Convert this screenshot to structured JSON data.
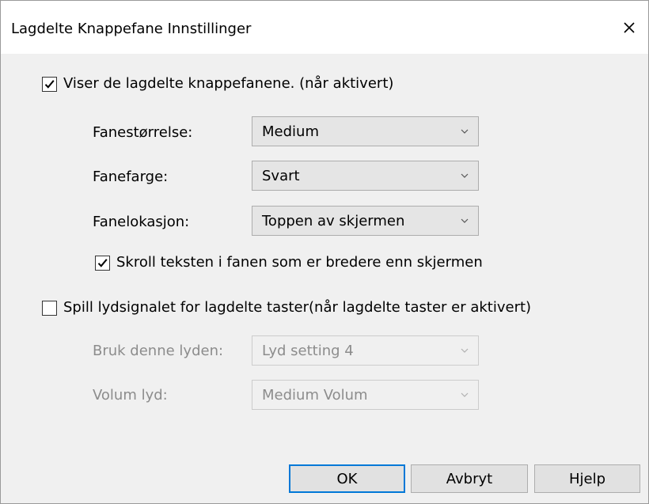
{
  "dialog": {
    "title": "Lagdelte Knappefane Innstillinger",
    "close_glyph": "×"
  },
  "show_tabs": {
    "checked": true,
    "label": "Viser de lagdelte knappefanene. (når aktivert)"
  },
  "tab_size": {
    "label": "Fanestørrelse:",
    "value": "Medium"
  },
  "tab_color": {
    "label": "Fanefarge:",
    "value": "Svart"
  },
  "tab_location": {
    "label": "Fanelokasjon:",
    "value": "Toppen av skjermen"
  },
  "scroll_text": {
    "checked": true,
    "label": "Skroll teksten i fanen som er bredere enn skjermen"
  },
  "play_sound": {
    "checked": false,
    "label": "Spill lydsignalet for lagdelte taster(når lagdelte taster er aktivert)"
  },
  "sound_choice": {
    "label": "Bruk denne lyden:",
    "value": "Lyd setting 4",
    "disabled": true
  },
  "sound_volume": {
    "label": "Volum lyd:",
    "value": "Medium Volum",
    "disabled": true
  },
  "buttons": {
    "ok": "OK",
    "cancel": "Avbryt",
    "help": "Hjelp"
  },
  "colors": {
    "focus_border": "#0078d7",
    "disabled_text": "#8c8c8c",
    "dialog_background": "#f0f0f0"
  },
  "icons": {
    "close": "close-icon",
    "check": "checkmark-icon",
    "dropdown": "chevron-down-icon"
  }
}
